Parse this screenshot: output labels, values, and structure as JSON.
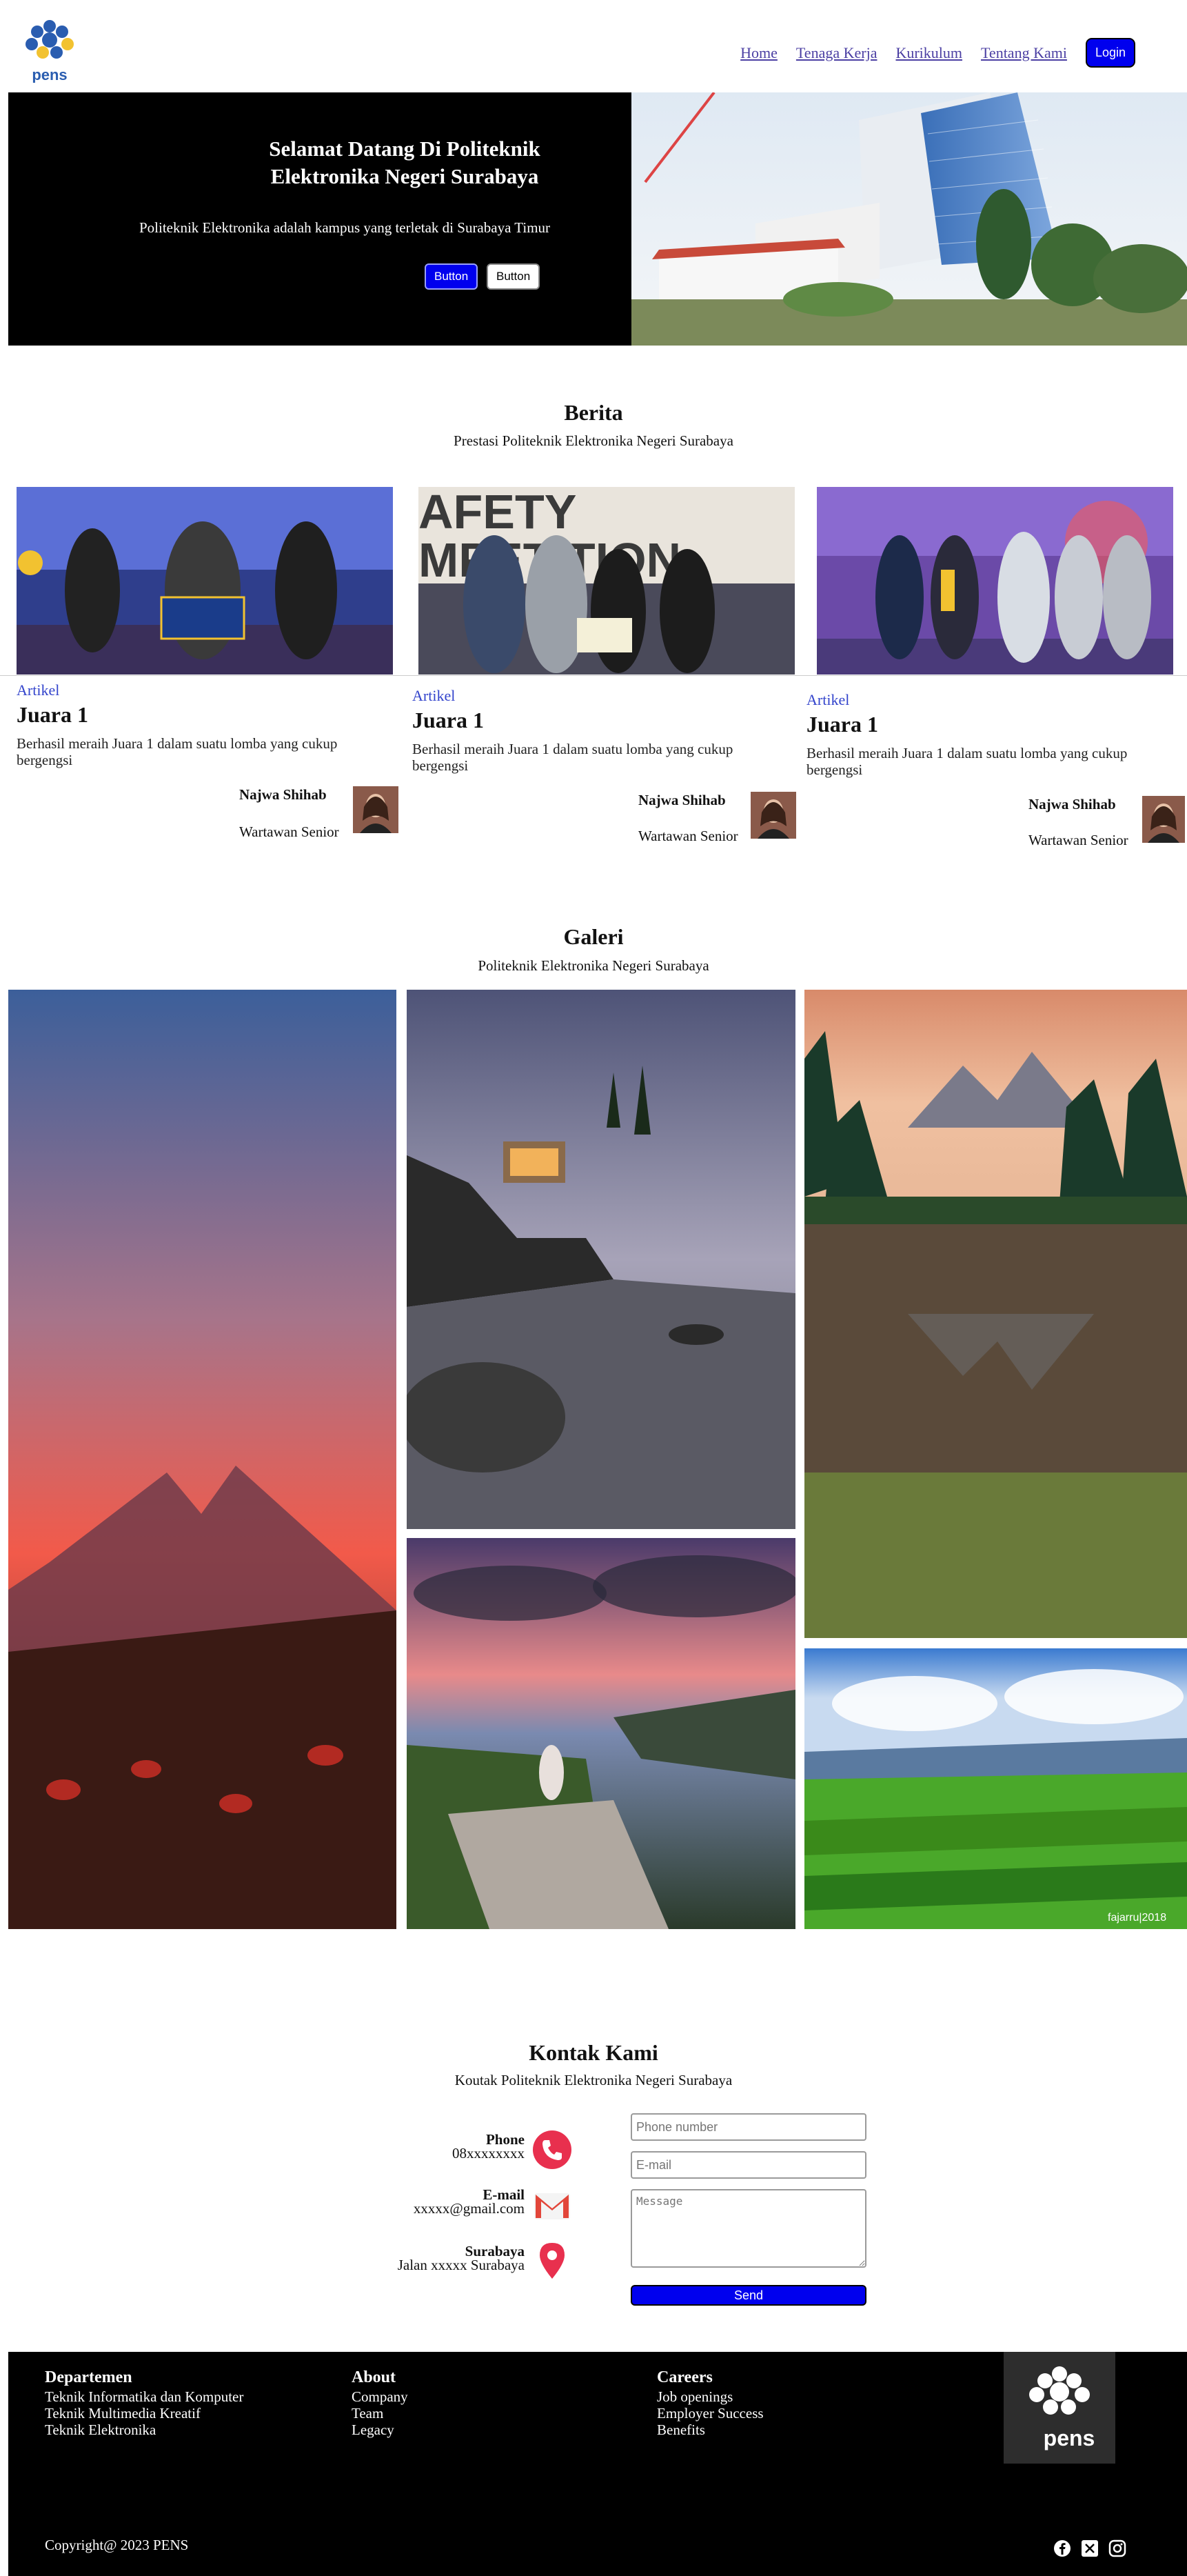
{
  "nav": {
    "links": [
      "Home",
      "Tenaga Kerja",
      "Kurikulum",
      "Tentang Kami"
    ],
    "login_label": "Login",
    "logo_text": "pens"
  },
  "hero": {
    "title": "Selamat Datang Di Politeknik Elektronika Negeri Surabaya",
    "subtitle": "Politeknik Elektronika adalah kampus yang terletak di Surabaya Timur",
    "button1": "Button",
    "button2": "Button"
  },
  "berita": {
    "title": "Berita",
    "subtitle": "Prestasi Politeknik Elektronika Negeri Surabaya",
    "cards": [
      {
        "category": "Artikel",
        "title": "Juara 1",
        "desc": "Berhasil meraih Juara 1 dalam suatu lomba yang cukup bergengsi",
        "author": "Najwa Shihab",
        "role": "Wartawan Senior"
      },
      {
        "category": "Artikel",
        "title": "Juara 1",
        "desc": "Berhasil meraih Juara 1 dalam suatu lomba yang cukup bergengsi",
        "author": "Najwa Shihab",
        "role": "Wartawan Senior"
      },
      {
        "category": "Artikel",
        "title": "Juara 1",
        "desc": "Berhasil meraih Juara 1 dalam suatu lomba yang cukup bergengsi",
        "author": "Najwa Shihab",
        "role": "Wartawan Senior"
      }
    ]
  },
  "galeri": {
    "title": "Galeri",
    "subtitle": "Politeknik Elektronika Negeri Surabaya"
  },
  "kontak": {
    "title": "Kontak Kami",
    "subtitle": "Koutak Politeknik Elektronika Negeri Surabaya",
    "phone_label": "Phone",
    "phone_value": "08xxxxxxxx",
    "email_label": "E-mail",
    "email_value": "xxxxx@gmail.com",
    "address_label": "Surabaya",
    "address_value": "Jalan xxxxx Surabaya",
    "form": {
      "phone_placeholder": "Phone number",
      "email_placeholder": "E-mail",
      "message_placeholder": "Message",
      "send_label": "Send"
    }
  },
  "footer": {
    "departemen": {
      "title": "Departemen",
      "items": [
        "Teknik Informatika dan Komputer",
        "Teknik Multimedia Kreatif",
        "Teknik Elektronika"
      ]
    },
    "about": {
      "title": "About",
      "items": [
        "Company",
        "Team",
        "Legacy"
      ]
    },
    "careers": {
      "title": "Careers",
      "items": [
        "Job openings",
        "Employer Success",
        "Benefits"
      ]
    },
    "copyright": "Copyright@ 2023 PENS",
    "social_icons": [
      "facebook-icon",
      "twitter-x-icon",
      "instagram-icon"
    ]
  },
  "colors": {
    "accent": "#0000ee",
    "link": "#4b3fa3",
    "category": "#3344cc",
    "contact_icon": "#e8304e"
  }
}
